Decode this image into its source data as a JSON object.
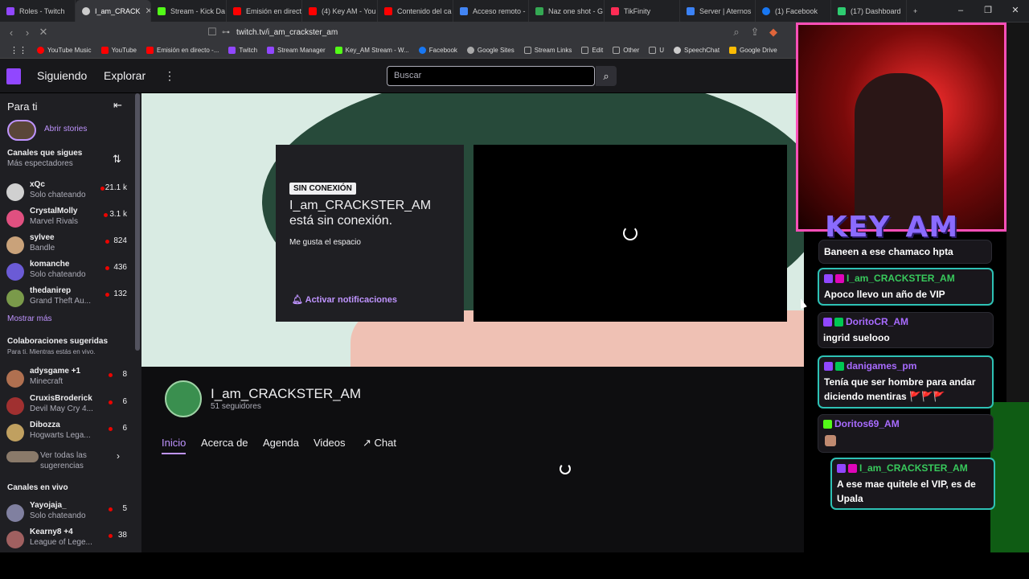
{
  "browser": {
    "tabs": [
      {
        "label": "Roles - Twitch",
        "color": "#9147ff"
      },
      {
        "label": "I_am_CRACK",
        "color": "#cccccc"
      },
      {
        "label": "Stream - Kick Da",
        "color": "#53fc18"
      },
      {
        "label": "Emisión en direct",
        "color": "#ff0000"
      },
      {
        "label": "(4) Key AM - You",
        "color": "#ff0000"
      },
      {
        "label": "Contenido del ca",
        "color": "#ff0000"
      },
      {
        "label": "Acceso remoto -",
        "color": "#4285f4"
      },
      {
        "label": "Naz one shot - G",
        "color": "#34a853"
      },
      {
        "label": "TikFinity",
        "color": "#fe2c55"
      },
      {
        "label": "Server | Aternos",
        "color": "#3b82f6"
      },
      {
        "label": "(1) Facebook",
        "color": "#1877f2"
      },
      {
        "label": "(17) Dashboard",
        "color": "#2ecc71"
      }
    ],
    "url": "twitch.tv/i_am_crackster_am",
    "bookmarks": [
      {
        "label": "YouTube Music",
        "color": "#ff0000"
      },
      {
        "label": "YouTube",
        "color": "#ff0000"
      },
      {
        "label": "Emisión en directo -...",
        "color": "#ff0000"
      },
      {
        "label": "Twitch",
        "color": "#9147ff"
      },
      {
        "label": "Stream Manager",
        "color": "#9147ff"
      },
      {
        "label": "Key_AM Stream - W...",
        "color": "#53fc18"
      },
      {
        "label": "Facebook",
        "color": "#1877f2"
      },
      {
        "label": "Google Sites",
        "color": "#aaaaaa"
      },
      {
        "label": "Stream Links",
        "color": "#888888"
      },
      {
        "label": "Edit",
        "color": "#888888"
      },
      {
        "label": "Other",
        "color": "#888888"
      },
      {
        "label": "U",
        "color": "#888888"
      },
      {
        "label": "SpeechChat",
        "color": "#cccccc"
      },
      {
        "label": "Google Drive",
        "color": "#fbbc04"
      }
    ]
  },
  "twitch": {
    "nav_following": "Siguiendo",
    "nav_browse": "Explorar",
    "search_placeholder": "Buscar",
    "sidebar": {
      "for_you": "Para ti",
      "open_stories": "Abrir stories",
      "followed_title": "Canales que sigues",
      "followed_sub": "Más espectadores",
      "followed": [
        {
          "name": "xQc",
          "game": "Solo chateando",
          "viewers": "21.1 k",
          "color": "#d0d0d0"
        },
        {
          "name": "CrystalMolly",
          "game": "Marvel Rivals",
          "viewers": "3.1 k",
          "color": "#e05080"
        },
        {
          "name": "sylvee",
          "game": "Bandle",
          "viewers": "824",
          "color": "#c9a27a"
        },
        {
          "name": "komanche",
          "game": "Solo chateando",
          "viewers": "436",
          "color": "#6b5bd6"
        },
        {
          "name": "thedanirep",
          "game": "Grand Theft Au...",
          "viewers": "132",
          "color": "#7a9a4a"
        }
      ],
      "show_more": "Mostrar más",
      "collab_title": "Colaboraciones sugeridas",
      "collab_sub": "Para ti. Mientras estás en vivo.",
      "collabs": [
        {
          "name": "adysgame +1",
          "game": "Minecraft",
          "viewers": "8",
          "color": "#b07050"
        },
        {
          "name": "CruxisBroderick",
          "game": "Devil May Cry 4...",
          "viewers": "6",
          "color": "#a03030"
        },
        {
          "name": "Dibozza",
          "game": "Hogwarts Lega...",
          "viewers": "6",
          "color": "#c0a060"
        }
      ],
      "see_all": "Ver todas las sugerencias",
      "live_title": "Canales en vivo",
      "live": [
        {
          "name": "Yayojaja_",
          "game": "Solo chateando",
          "viewers": "5",
          "color": "#8080a0"
        },
        {
          "name": "Kearny8 +4",
          "game": "League of Lege...",
          "viewers": "38",
          "color": "#a06060"
        }
      ]
    },
    "offline": {
      "badge": "SIN CONEXIÓN",
      "title": "I_am_CRACKSTER_AM está sin conexión.",
      "subtitle": "Me gusta el espacio",
      "notify": "Activar notificaciones"
    },
    "channel": {
      "name": "I_am_CRACKSTER_AM",
      "followers": "51 seguidores",
      "tabs": [
        "Inicio",
        "Acerca de",
        "Agenda",
        "Videos",
        "Chat"
      ]
    }
  },
  "overlay": {
    "cam_title": "KEY_AM",
    "chat": [
      {
        "user": "",
        "text": "Baneen a ese chamaco hpta"
      },
      {
        "user": "I_am_CRACKSTER_AM",
        "text": "Apoco llevo un año de VIP"
      },
      {
        "user": "DoritoCR_AM",
        "text": "ingrid suelooo"
      },
      {
        "user": "danigames_pm",
        "text": "Tenía que ser hombre para andar diciendo mentiras 🚩🚩🚩"
      },
      {
        "user": "Doritos69_AM",
        "text": ""
      },
      {
        "user": "I_am_CRACKSTER_AM",
        "text": "A ese mae quitele el VIP, es de Upala"
      }
    ]
  }
}
